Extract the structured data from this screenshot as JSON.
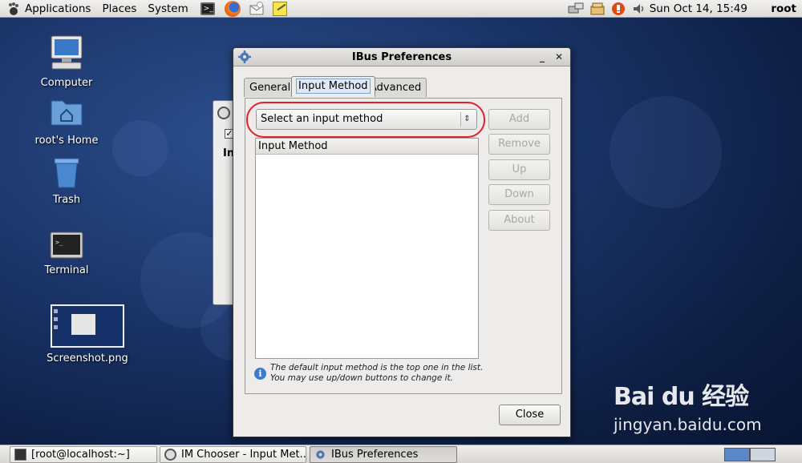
{
  "top_panel": {
    "menus": [
      "Applications",
      "Places",
      "System"
    ],
    "clock": "Sun Oct 14, 15:49",
    "user": "root"
  },
  "desktop": {
    "icons": [
      {
        "label": "Computer",
        "icon": "computer-icon"
      },
      {
        "label": "root's Home",
        "icon": "home-folder-icon"
      },
      {
        "label": "Trash",
        "icon": "trash-icon"
      },
      {
        "label": "Terminal",
        "icon": "terminal-icon"
      },
      {
        "label": "Screenshot.png",
        "icon": "image-thumbnail-icon"
      }
    ]
  },
  "dialog": {
    "title": "IBus Preferences",
    "tabs": [
      "General",
      "Input Method",
      "Advanced"
    ],
    "active_tab": "Input Method",
    "combo_value": "Select an input method",
    "list_header": "Input Method",
    "buttons": {
      "add": "Add",
      "remove": "Remove",
      "up": "Up",
      "down": "Down",
      "about": "About",
      "close": "Close"
    },
    "info_line1": "The default input method is the top one in the list.",
    "info_line2": "You may use up/down buttons to change it.",
    "highlight_color": "#e0202a"
  },
  "background_window": {
    "partial_label": "In"
  },
  "taskbar": {
    "tasks": [
      "[root@localhost:~]",
      "IM Chooser - Input Met...",
      "IBus Preferences"
    ]
  },
  "watermark": {
    "brand": "Bai du 经验",
    "url": "jingyan.baidu.com"
  }
}
